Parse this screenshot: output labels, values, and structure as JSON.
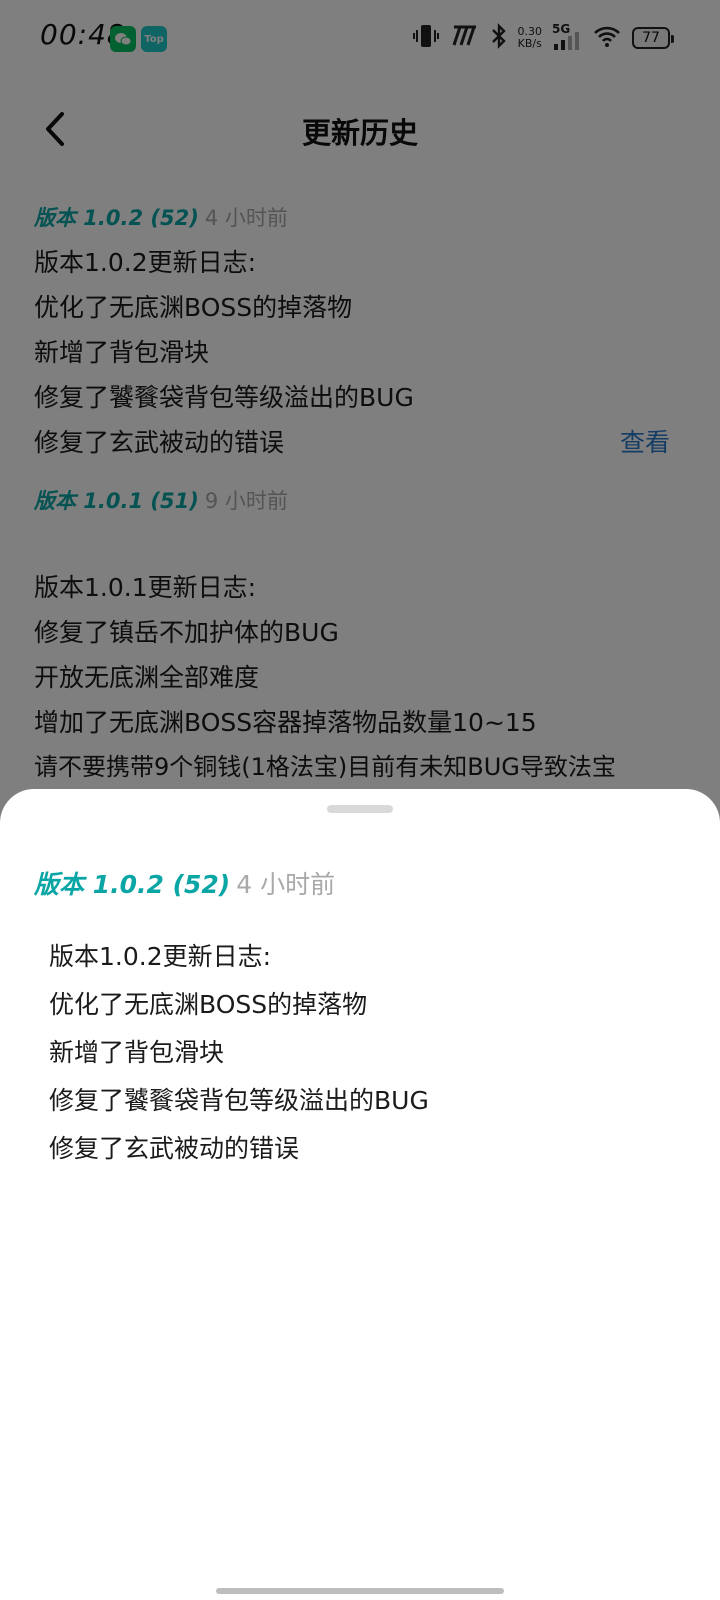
{
  "status_bar": {
    "time": "00:48",
    "apps": [
      {
        "icon": "wechat-icon",
        "label": ""
      },
      {
        "icon": "top-app-icon",
        "label": "Top"
      }
    ],
    "net_speed_value": "0.30",
    "net_speed_unit": "KB/s",
    "network": "5G",
    "battery": "77"
  },
  "header": {
    "back_icon": "chevron-left-icon",
    "title": "更新历史"
  },
  "history": [
    {
      "version": "版本 1.0.2 (52)",
      "time_ago": "4 小时前",
      "lines": [
        "版本1.0.2更新日志:",
        "优化了无底渊BOSS的掉落物",
        "新增了背包滑块",
        "修复了饕餮袋背包等级溢出的BUG",
        "修复了玄武被动的错误"
      ],
      "view_label": "查看"
    },
    {
      "version": "版本 1.0.1 (51)",
      "time_ago": "9 小时前",
      "lines": [
        "",
        "版本1.0.1更新日志:",
        "修复了镇岳不加护体的BUG",
        "开放无底渊全部难度",
        "增加了无底渊BOSS容器掉落物品数量10~15",
        "请不要携带9个铜钱(1格法宝)目前有未知BUG导致法宝"
      ]
    }
  ],
  "sheet": {
    "version": "版本 1.0.2 (52)",
    "time_ago": "4 小时前",
    "lines": [
      "版本1.0.2更新日志:",
      "优化了无底渊BOSS的掉落物",
      "新增了背包滑块",
      "修复了饕餮袋背包等级溢出的BUG",
      "修复了玄武被动的错误"
    ]
  },
  "colors": {
    "version_accent": "#0aa5a5",
    "time_gray": "#a9a9a9",
    "link_blue": "#2a78c8",
    "scrim": "rgba(0,0,0,0.5)"
  }
}
